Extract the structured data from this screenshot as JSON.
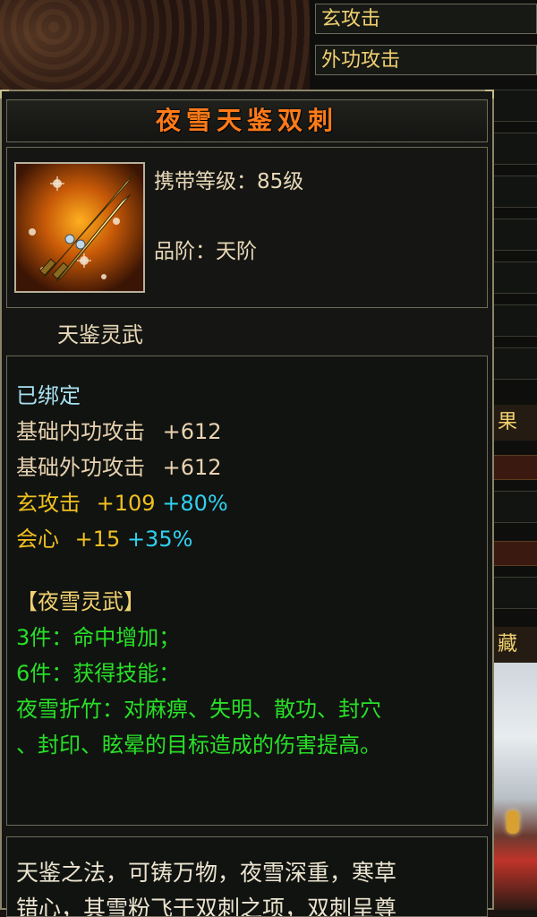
{
  "window_stats": {
    "row1": "玄攻击",
    "row2": "外功攻击"
  },
  "right_labels": {
    "guo": "果",
    "cang": "藏"
  },
  "item": {
    "name": "夜雪天鉴双刺",
    "carry_level": "携带等级：85级",
    "grade": "品阶：天阶",
    "category": "天鉴灵武"
  },
  "stats": {
    "bound": "已绑定",
    "base_internal": {
      "label": "基础内功攻击",
      "value": "+612"
    },
    "base_external": {
      "label": "基础外功攻击",
      "value": "+612"
    },
    "xuan_attack": {
      "label": "玄攻击",
      "value": "+109",
      "bonus": "+80%"
    },
    "crit": {
      "label": "会心",
      "value": "+15",
      "bonus": "+35%"
    }
  },
  "set": {
    "name": "【夜雪灵武】",
    "piece3": "3件：命中增加；",
    "piece6": "6件：获得技能：",
    "skill_line1": "夜雪折竹：对麻痹、失明、散功、封穴",
    "skill_line2": "、封印、眩晕的目标造成的伤害提高。"
  },
  "description": {
    "line1": "天鉴之法，可铸万物，夜雪深重，寒草",
    "line2": "错心，其雪粉飞于双刺之项，双刺呈尊"
  },
  "colors": {
    "title": "#ff7a18",
    "set_green": "#28e028",
    "bonus_cyan": "#30d0f0",
    "gold": "#f0c020"
  }
}
